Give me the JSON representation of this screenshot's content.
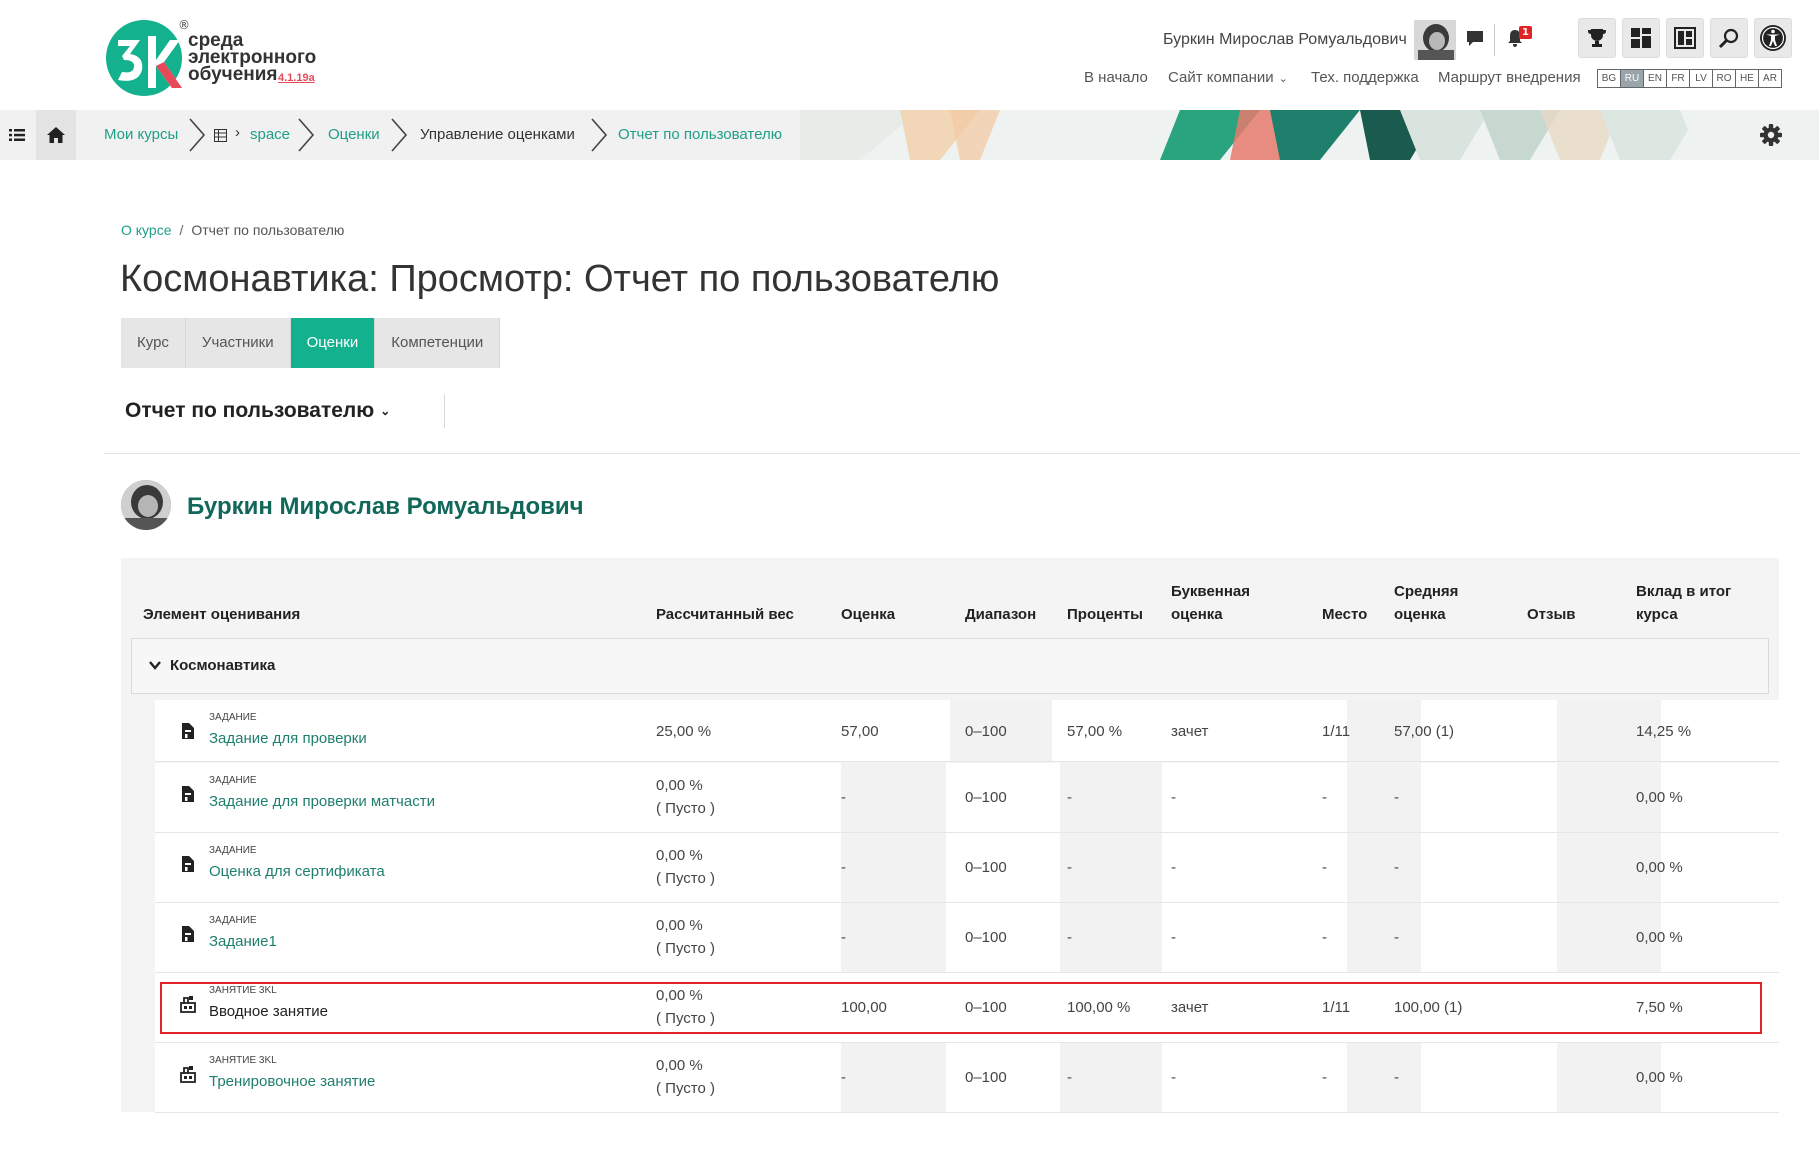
{
  "header": {
    "logo_line1": "среда",
    "logo_line2": "электронного",
    "logo_line3": "обучения",
    "logo_version": "4.1.19a",
    "logo_reg": "®",
    "user_name": "Буркин Мирослав Ромуальдович",
    "notifications_count": "1",
    "nav": {
      "home": "В начало",
      "company_site": "Сайт компании",
      "support": "Тех. поддержка",
      "route": "Маршрут внедрения"
    },
    "languages": [
      "BG",
      "RU",
      "EN",
      "FR",
      "LV",
      "RO",
      "HE",
      "AR"
    ],
    "active_language": "RU"
  },
  "breadcrumb_bar": {
    "my_courses": "Мои курсы",
    "space": "space",
    "grades": "Оценки",
    "grade_management": "Управление оценками",
    "user_report": "Отчет по пользователю"
  },
  "page": {
    "crumbs": {
      "course": "О курсе",
      "separator": "/",
      "current": "Отчет по пользователю"
    },
    "title": "Космонавтика: Просмотр: Отчет по пользователю",
    "tabs": [
      "Курс",
      "Участники",
      "Оценки",
      "Компетенции"
    ],
    "active_tab": "Оценки",
    "report_selector": "Отчет по пользователю",
    "student_name": "Буркин Мирослав Ромуальдович"
  },
  "table": {
    "headers": {
      "item": "Элемент оценивания",
      "weight": "Рассчитанный вес",
      "grade": "Оценка",
      "range": "Диапазон",
      "percent": "Проценты",
      "letter_1": "Буквенная",
      "letter_2": "оценка",
      "rank": "Место",
      "average_1": "Средняя",
      "average_2": "оценка",
      "feedback": "Отзыв",
      "contrib_1": "Вклад в итог",
      "contrib_2": "курса"
    },
    "category": "Космонавтика",
    "rows": [
      {
        "type": "Задание",
        "name": "Задание для проверки",
        "weight": "25,00 %",
        "weight_note": "",
        "grade": "57,00",
        "range": "0–100",
        "percent": "57,00 %",
        "letter": "зачет",
        "rank": "1/11",
        "average": "57,00 (1)",
        "feedback": "",
        "contribution": "14,25 %"
      },
      {
        "type": "Задание",
        "name": "Задание для проверки матчасти",
        "weight": "0,00 %",
        "weight_note": "( Пусто )",
        "grade": "-",
        "range": "0–100",
        "percent": "-",
        "letter": "-",
        "rank": "-",
        "average": "-",
        "feedback": "",
        "contribution": "0,00 %"
      },
      {
        "type": "Задание",
        "name": "Оценка для сертификата",
        "weight": "0,00 %",
        "weight_note": "( Пусто )",
        "grade": "-",
        "range": "0–100",
        "percent": "-",
        "letter": "-",
        "rank": "-",
        "average": "-",
        "feedback": "",
        "contribution": "0,00 %"
      },
      {
        "type": "Задание",
        "name": "Задание1",
        "weight": "0,00 %",
        "weight_note": "( Пусто )",
        "grade": "-",
        "range": "0–100",
        "percent": "-",
        "letter": "-",
        "rank": "-",
        "average": "-",
        "feedback": "",
        "contribution": "0,00 %"
      },
      {
        "type": "Занятие 3KL",
        "name": "Вводное занятие",
        "weight": "0,00 %",
        "weight_note": "( Пусто )",
        "grade": "100,00",
        "range": "0–100",
        "percent": "100,00 %",
        "letter": "зачет",
        "rank": "1/11",
        "average": "100,00 (1)",
        "feedback": "",
        "contribution": "7,50 %"
      },
      {
        "type": "Занятие 3KL",
        "name": "Тренировочное занятие",
        "weight": "0,00 %",
        "weight_note": "( Пусто )",
        "grade": "-",
        "range": "0–100",
        "percent": "-",
        "letter": "-",
        "rank": "-",
        "average": "-",
        "feedback": "",
        "contribution": "0,00 %"
      }
    ]
  },
  "colors": {
    "accent": "#14b18f",
    "link": "#1f9e88",
    "student_name": "#11685a",
    "highlight": "#e02424"
  }
}
